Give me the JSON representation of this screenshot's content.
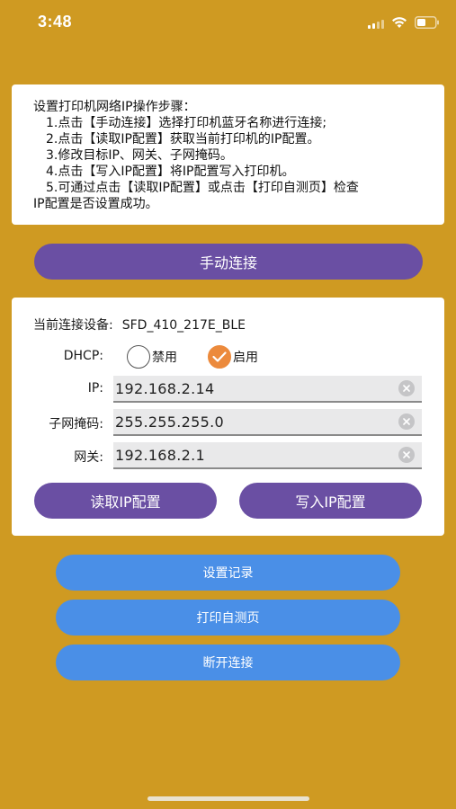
{
  "status_bar": {
    "time": "3:48",
    "icons": [
      "signal-icon",
      "wifi-icon",
      "battery-icon"
    ],
    "text_color": "#ffffff"
  },
  "colors": {
    "background": "#cf9a22",
    "card": "#ffffff",
    "primary_button": "#6a4fa3",
    "secondary_button": "#4a8fe7",
    "radio_checked": "#ec8a3c"
  },
  "instructions": {
    "title": "设置打印机网络IP操作步骤：",
    "step1": "1.点击【手动连接】选择打印机蓝牙名称进行连接;",
    "step2": "2.点击【读取IP配置】获取当前打印机的IP配置。",
    "step3": "3.修改目标IP、网关、子网掩码。",
    "step4": "4.点击【写入IP配置】将IP配置写入打印机。",
    "step5": "5.可通过点击【读取IP配置】或点击【打印自测页】检查",
    "step5_cont": "IP配置是否设置成功。"
  },
  "manual_connect": {
    "label": "手动连接"
  },
  "config": {
    "device_label": "当前连接设备:",
    "device_name": "SFD_410_217E_BLE",
    "dhcp": {
      "label": "DHCP:",
      "option_disabled": "禁用",
      "option_enabled": "启用",
      "selected": "启用"
    },
    "ip": {
      "label": "IP:",
      "value": "192.168.2.14"
    },
    "subnet_mask": {
      "label": "子网掩码:",
      "value": "255.255.255.0"
    },
    "gateway": {
      "label": "网关:",
      "value": "192.168.2.1"
    },
    "read_button": "读取IP配置",
    "write_button": "写入IP配置"
  },
  "actions": {
    "records": "设置记录",
    "self_test": "打印自测页",
    "disconnect": "断开连接"
  }
}
